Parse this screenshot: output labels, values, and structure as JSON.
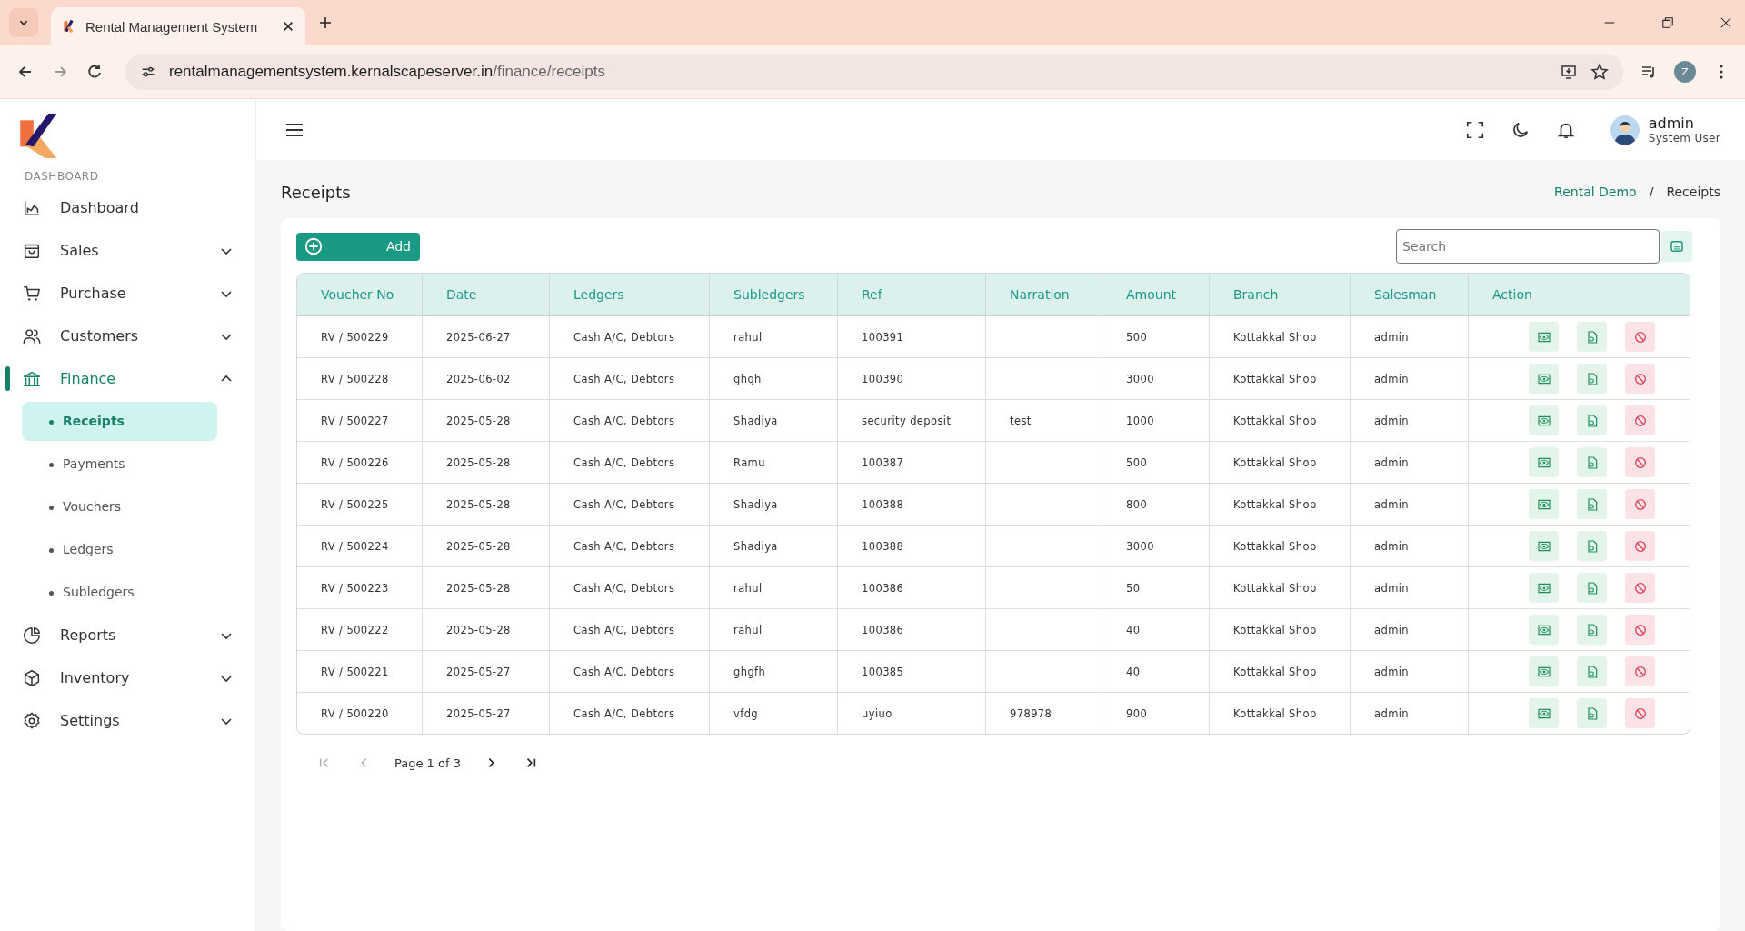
{
  "browser": {
    "tab_title": "Rental Management System",
    "url_host": "rentalmanagementsystem.kernalscapeserver.in",
    "url_path": "/finance/receipts",
    "profile_initial": "Z"
  },
  "sidebar": {
    "section_label": "DASHBOARD",
    "items": [
      {
        "label": "Dashboard",
        "kind": "link",
        "selected": false
      },
      {
        "label": "Sales",
        "kind": "group",
        "expanded": false,
        "selected": false
      },
      {
        "label": "Purchase",
        "kind": "group",
        "expanded": false,
        "selected": false
      },
      {
        "label": "Customers",
        "kind": "group",
        "expanded": false,
        "selected": false
      },
      {
        "label": "Finance",
        "kind": "group",
        "expanded": true,
        "selected": true,
        "children": [
          {
            "label": "Receipts",
            "selected": true
          },
          {
            "label": "Payments",
            "selected": false
          },
          {
            "label": "Vouchers",
            "selected": false
          },
          {
            "label": "Ledgers",
            "selected": false
          },
          {
            "label": "Subledgers",
            "selected": false
          }
        ]
      },
      {
        "label": "Reports",
        "kind": "group",
        "expanded": false,
        "selected": false
      },
      {
        "label": "Inventory",
        "kind": "group",
        "expanded": false,
        "selected": false
      },
      {
        "label": "Settings",
        "kind": "group",
        "expanded": false,
        "selected": false
      }
    ]
  },
  "user": {
    "name": "admin",
    "role": "System User"
  },
  "page": {
    "title": "Receipts",
    "breadcrumb_separator": "/",
    "breadcrumb": [
      {
        "label": "Rental Demo",
        "kind": "link"
      },
      {
        "label": "Receipts",
        "kind": "current"
      }
    ]
  },
  "toolbar": {
    "add_label": "Add",
    "search": {
      "placeholder": "Search"
    }
  },
  "table": {
    "columns": [
      "Voucher No",
      "Date",
      "Ledgers",
      "Subledgers",
      "Ref",
      "Narration",
      "Amount",
      "Branch",
      "Salesman",
      "Action"
    ],
    "rows": [
      {
        "voucher_no": "RV / 500229",
        "date": "2025-06-27",
        "ledgers": "Cash A/C, Debtors",
        "subledgers": "rahul",
        "ref": "100391",
        "amount": "500",
        "branch": "Kottakkal Shop",
        "salesman": "admin"
      },
      {
        "voucher_no": "RV / 500228",
        "date": "2025-06-02",
        "ledgers": "Cash A/C, Debtors",
        "subledgers": "ghgh",
        "ref": "100390",
        "amount": "3000",
        "branch": "Kottakkal Shop",
        "salesman": "admin"
      },
      {
        "voucher_no": "RV / 500227",
        "date": "2025-05-28",
        "ledgers": "Cash A/C, Debtors",
        "subledgers": "Shadiya",
        "ref": "security deposit",
        "narration": "test",
        "amount": "1000",
        "branch": "Kottakkal Shop",
        "salesman": "admin"
      },
      {
        "voucher_no": "RV / 500226",
        "date": "2025-05-28",
        "ledgers": "Cash A/C, Debtors",
        "subledgers": "Ramu",
        "ref": "100387",
        "amount": "500",
        "branch": "Kottakkal Shop",
        "salesman": "admin"
      },
      {
        "voucher_no": "RV / 500225",
        "date": "2025-05-28",
        "ledgers": "Cash A/C, Debtors",
        "subledgers": "Shadiya",
        "ref": "100388",
        "amount": "800",
        "branch": "Kottakkal Shop",
        "salesman": "admin"
      },
      {
        "voucher_no": "RV / 500224",
        "date": "2025-05-28",
        "ledgers": "Cash A/C, Debtors",
        "subledgers": "Shadiya",
        "ref": "100388",
        "amount": "3000",
        "branch": "Kottakkal Shop",
        "salesman": "admin"
      },
      {
        "voucher_no": "RV / 500223",
        "date": "2025-05-28",
        "ledgers": "Cash A/C, Debtors",
        "subledgers": "rahul",
        "ref": "100386",
        "amount": "50",
        "branch": "Kottakkal Shop",
        "salesman": "admin"
      },
      {
        "voucher_no": "RV / 500222",
        "date": "2025-05-28",
        "ledgers": "Cash A/C, Debtors",
        "subledgers": "rahul",
        "ref": "100386",
        "amount": "40",
        "branch": "Kottakkal Shop",
        "salesman": "admin"
      },
      {
        "voucher_no": "RV / 500221",
        "date": "2025-05-27",
        "ledgers": "Cash A/C, Debtors",
        "subledgers": "ghgfh",
        "ref": "100385",
        "amount": "40",
        "branch": "Kottakkal Shop",
        "salesman": "admin"
      },
      {
        "voucher_no": "RV / 500220",
        "date": "2025-05-27",
        "ledgers": "Cash A/C, Debtors",
        "subledgers": "vfdg",
        "ref": "uyiuo",
        "narration": "978978",
        "amount": "900",
        "branch": "Kottakkal Shop",
        "salesman": "admin"
      }
    ]
  },
  "pagination": {
    "label": "Page 1 of 3",
    "first_disabled": true,
    "prev_disabled": true,
    "next_disabled": false,
    "last_disabled": false
  }
}
